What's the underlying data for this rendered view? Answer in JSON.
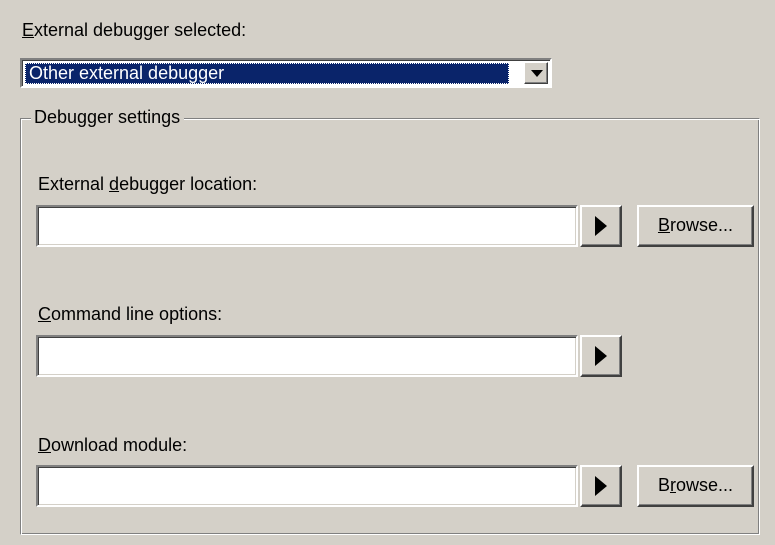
{
  "debugger_select": {
    "label_accel": "E",
    "label_rest": "xternal debugger selected:",
    "selected_value": "Other external debugger"
  },
  "settings_group": {
    "title": "Debugger settings",
    "location": {
      "label_pre": "External ",
      "label_accel": "d",
      "label_post": "ebugger location:",
      "value": "",
      "browse_accel": "B",
      "browse_rest": "rowse..."
    },
    "command_line": {
      "label_accel": "C",
      "label_rest": "ommand line options:",
      "value": ""
    },
    "download": {
      "label_accel": "D",
      "label_rest": "ownload module:",
      "value": "",
      "browse_pre": "B",
      "browse_accel": "r",
      "browse_post": "owse..."
    }
  },
  "icons": {
    "dropdown": "chevron-down-icon",
    "expand": "triangle-right-icon"
  },
  "colors": {
    "face": "#d4d0c8",
    "selection": "#0a246a"
  }
}
